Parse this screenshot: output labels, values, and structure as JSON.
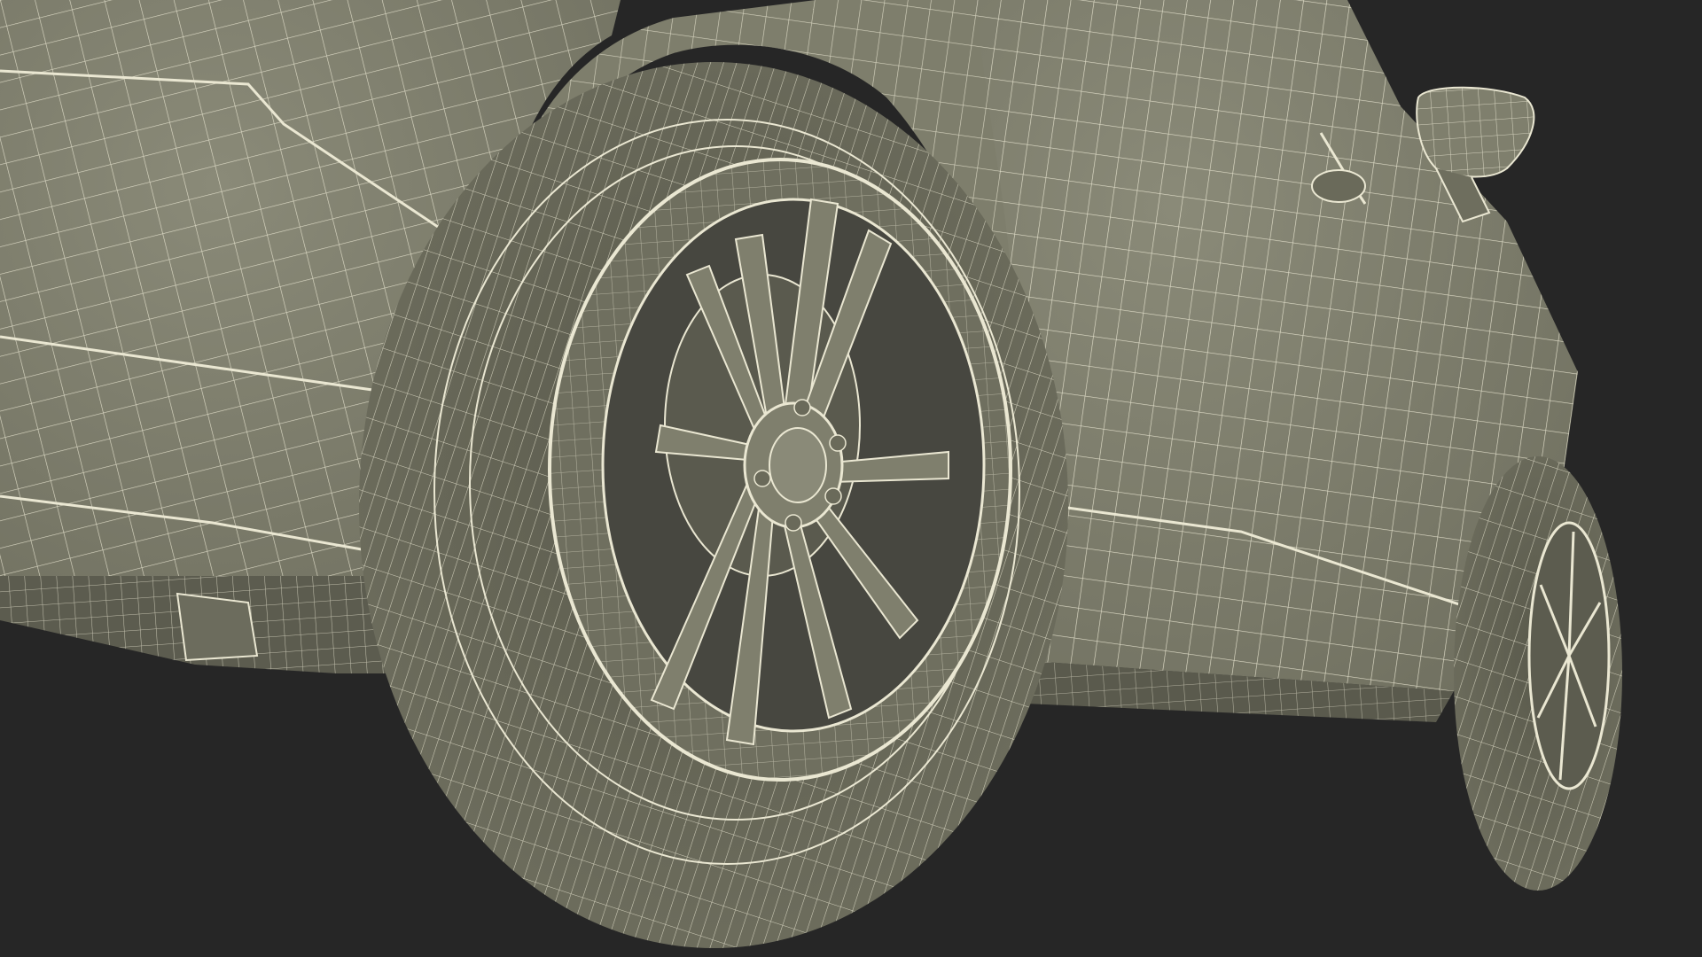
{
  "scene": {
    "subject": "car",
    "view": "wireframe-on-shaded",
    "colors": {
      "background": "#262626",
      "surface": "#7d7d6b",
      "surface_dark": "#5e5e50",
      "surface_light": "#8a8a78",
      "wire": "#eae7d2"
    }
  }
}
